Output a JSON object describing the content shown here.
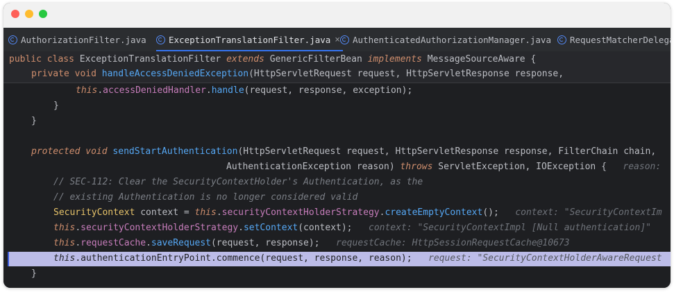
{
  "tabs": [
    {
      "label": "AuthorizationFilter.java"
    },
    {
      "label": "ExceptionTranslationFilter.java",
      "close": "×"
    },
    {
      "label": "AuthenticatedAuthorizationManager.java"
    },
    {
      "label": "RequestMatcherDelegat"
    }
  ],
  "sticky": {
    "l1": {
      "public": "public",
      "class": "class",
      "name": "ExceptionTranslationFilter",
      "extends": "extends",
      "base": "GenericFilterBean",
      "implements": "implements",
      "iface": "MessageSourceAware",
      "brace": " {"
    },
    "l2": {
      "private": "private",
      "void": "void",
      "method": "handleAccessDeniedException",
      "open": "(",
      "t1": "HttpServletRequest",
      "p1": "request",
      "sep": ", ",
      "t2": "HttpServletResponse",
      "p2": "response",
      "tail": ","
    }
  },
  "code": {
    "l3": {
      "this": "this",
      "dot1": ".",
      "field": "accessDeniedHandler",
      "dot2": ".",
      "method": "handle",
      "args": "(request, response, exception);"
    },
    "l4": {
      "text": "}"
    },
    "l5": {
      "text": "}"
    },
    "l7": {
      "protected": "protected",
      "void": "void",
      "method": "sendStartAuthentication",
      "open": "(",
      "t1": "HttpServletRequest",
      "p1": "request",
      "sep1": ", ",
      "t2": "HttpServletResponse",
      "p2": "response",
      "sep2": ", ",
      "t3": "FilterChain",
      "p3": "chain",
      "tail": ","
    },
    "l8": {
      "t4": "AuthenticationException",
      "p4": "reason",
      "close": ") ",
      "throws": "throws",
      "ex1": "ServletException",
      "sep": ", ",
      "ex2": "IOException",
      "brace": " {",
      "hint": "reason: "
    },
    "l9": {
      "text": "// SEC-112: Clear the SecurityContextHolder's Authentication, as the"
    },
    "l10": {
      "text": "// existing Authentication is no longer considered valid"
    },
    "l11": {
      "type": "SecurityContext",
      "var": " context = ",
      "this": "this",
      "dot1": ".",
      "field": "securityContextHolderStrategy",
      "dot2": ".",
      "method": "createEmptyContext",
      "end": "();",
      "hint": "context: \"SecurityContextIm"
    },
    "l12": {
      "this": "this",
      "dot1": ".",
      "field": "securityContextHolderStrategy",
      "dot2": ".",
      "method": "setContext",
      "args": "(context);",
      "hint": "context: \"SecurityContextImpl [Null authentication]\""
    },
    "l13": {
      "this": "this",
      "dot1": ".",
      "field": "requestCache",
      "dot2": ".",
      "method": "saveRequest",
      "args": "(request, response);",
      "hint": "requestCache: HttpSessionRequestCache@10673"
    },
    "l14": {
      "this": "this",
      "rest": ".authenticationEntryPoint.commence(request, response, reason);",
      "hint": "request: \"SecurityContextHolderAwareRequest"
    },
    "l15": {
      "text": "}"
    }
  }
}
